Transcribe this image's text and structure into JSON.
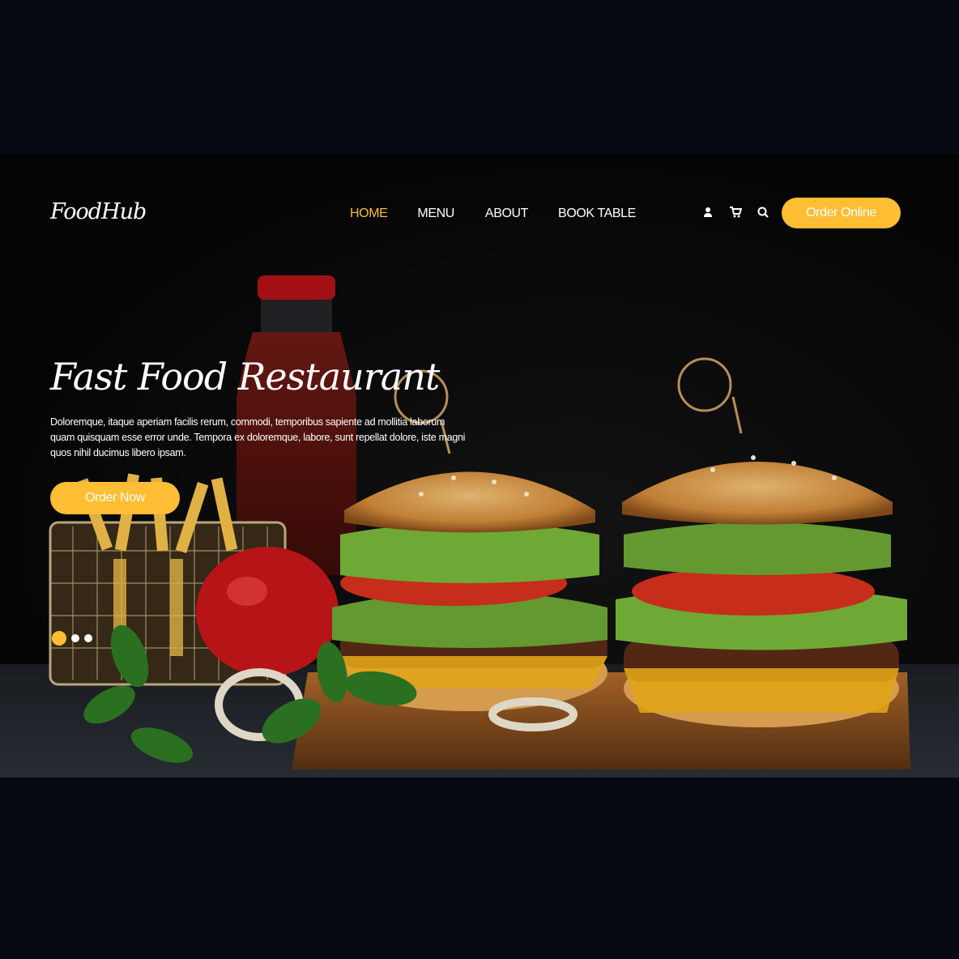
{
  "header": {
    "logo": "FoodHub",
    "nav": [
      {
        "label": "HOME",
        "active": true
      },
      {
        "label": "MENU",
        "active": false
      },
      {
        "label": "ABOUT",
        "active": false
      },
      {
        "label": "BOOK TABLE",
        "active": false
      }
    ],
    "icons": [
      "user-icon",
      "cart-icon",
      "search-icon"
    ],
    "order_online_label": "Order Online"
  },
  "hero": {
    "title": "Fast Food Restaurant",
    "description": "Doloremque, itaque aperiam facilis rerum, commodi, temporibus sapiente ad mollitia laborum quam quisquam esse error unde. Tempora ex doloremque, labore, sunt repellat dolore, iste magni quos nihil ducimus libero ipsam.",
    "order_now_label": "Order Now",
    "slides": [
      {
        "active": true
      },
      {
        "active": false
      },
      {
        "active": false
      }
    ]
  },
  "colors": {
    "accent": "#ffbe33",
    "background": "#070a12",
    "text": "#ffffff"
  }
}
